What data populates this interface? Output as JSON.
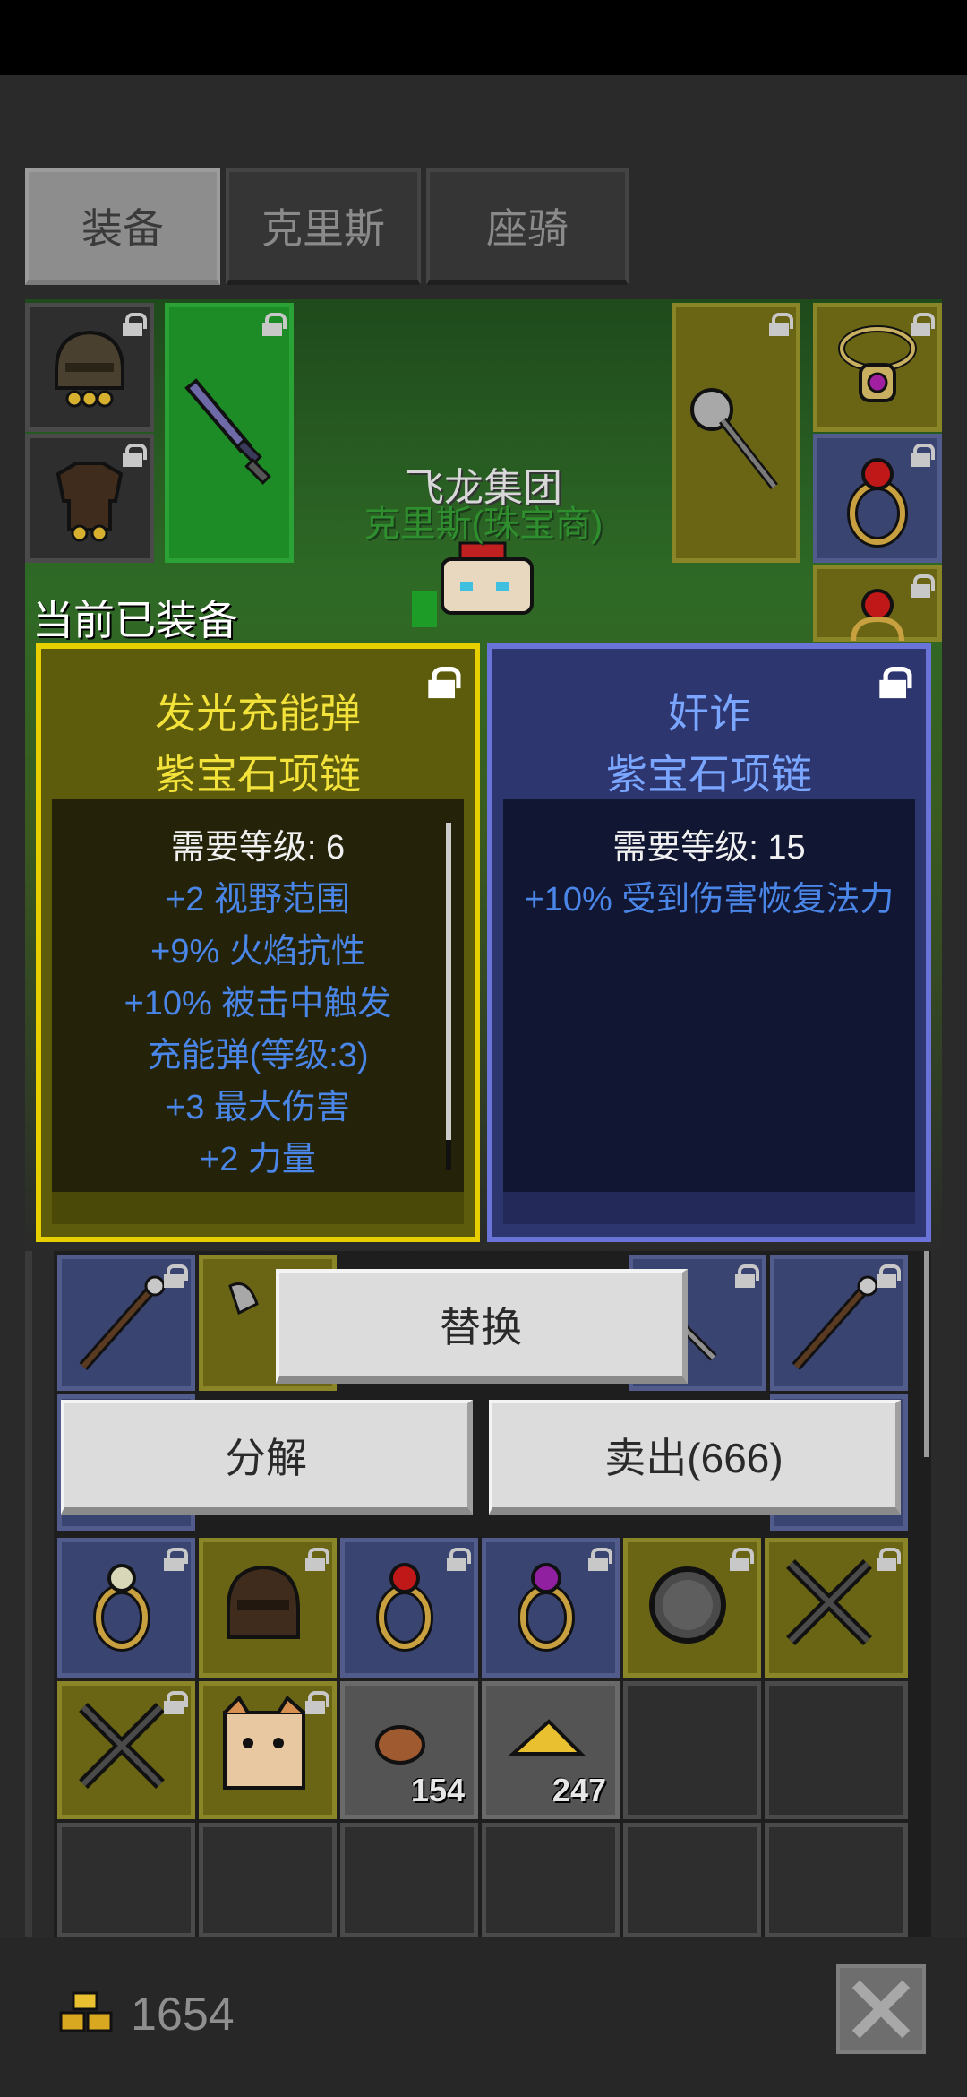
{
  "tabs": [
    {
      "label": "装备",
      "active": true
    },
    {
      "label": "克里斯",
      "active": false
    },
    {
      "label": "座骑",
      "active": false
    }
  ],
  "character": {
    "shop_name": "飞龙集团",
    "npc_name": "克里斯(珠宝商)"
  },
  "current_equipped_label": "当前已装备",
  "equipped_item": {
    "prefix": "发光充能弹",
    "name": "紫宝石项链",
    "level_req": "需要等级: 6",
    "stats": [
      "+2 视野范围",
      "+9% 火焰抗性",
      "+10% 被击中触发",
      "充能弹(等级:3)",
      "+3 最大伤害",
      "+2 力量"
    ],
    "rarity_color": "#e8d000"
  },
  "new_item": {
    "prefix": "奸诈",
    "name": "紫宝石项链",
    "level_req": "需要等级: 15",
    "stats": [
      "+10% 受到伤害恢复法力"
    ],
    "rarity_color": "#6a74d8"
  },
  "actions": {
    "replace": "替换",
    "disassemble": "分解",
    "sell": "卖出(666)"
  },
  "inventory": {
    "counts": {
      "meat": "154",
      "cheese": "247"
    }
  },
  "gold": "1654",
  "icons": {
    "lock": "lock-icon",
    "gold": "gold-coins-icon",
    "close": "close-icon"
  }
}
